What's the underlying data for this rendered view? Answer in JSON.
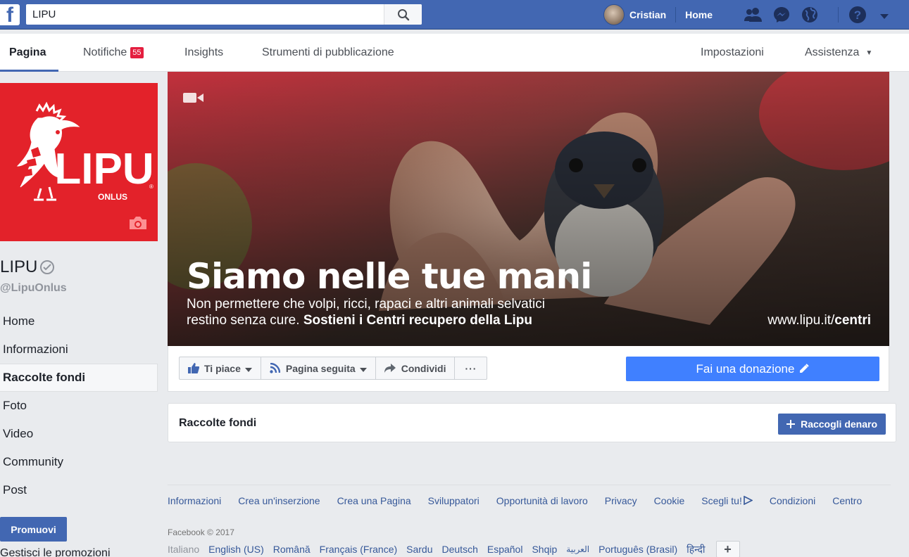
{
  "topbar": {
    "search_value": "LIPU",
    "user_name": "Cristian",
    "home_label": "Home",
    "brand_color": "#4267b2"
  },
  "page_tabs": [
    {
      "label": "Pagina",
      "active": true
    },
    {
      "label": "Notifiche",
      "badge": "55"
    },
    {
      "label": "Insights"
    },
    {
      "label": "Strumenti di pubblicazione"
    },
    {
      "label": "Impostazioni"
    },
    {
      "label": "Assistenza",
      "dropdown": true
    }
  ],
  "profile": {
    "logo_text": "LIPU",
    "logo_sub": "ONLUS",
    "page_name": "LIPU",
    "username": "@LipuOnlus",
    "logo_bg": "#e3222a"
  },
  "nav": [
    {
      "label": "Home"
    },
    {
      "label": "Informazioni"
    },
    {
      "label": "Raccolte fondi",
      "active": true
    },
    {
      "label": "Foto"
    },
    {
      "label": "Video"
    },
    {
      "label": "Community"
    },
    {
      "label": "Post"
    }
  ],
  "promote": {
    "button": "Promuovi",
    "manage": "Gestisci le promozioni"
  },
  "cover": {
    "title": "Siamo nelle tue mani",
    "line1": "Non permettere che volpi, ricci, rapaci e altri animali selvatici",
    "line2_a": "restino senza cure. ",
    "line2_b": "Sostieni i Centri recupero della Lipu",
    "url_a": "www.lipu.it/",
    "url_b": "centri"
  },
  "actions": {
    "like": "Ti piace",
    "follow": "Pagina seguita",
    "share": "Condividi",
    "more": "···",
    "donate": "Fai una donazione"
  },
  "fundraisers": {
    "title": "Raccolte fondi",
    "button": "Raccogli denaro"
  },
  "footer": {
    "links": [
      "Informazioni",
      "Crea un'inserzione",
      "Crea una Pagina",
      "Sviluppatori",
      "Opportunità di lavoro",
      "Privacy",
      "Cookie",
      "Scegli tu!",
      "Condizioni",
      "Centro"
    ],
    "copyright": "Facebook © 2017",
    "current_language": "Italiano",
    "languages": [
      "English (US)",
      "Română",
      "Français (France)",
      "Sardu",
      "Deutsch",
      "Español",
      "Shqip",
      "العربية",
      "Português (Brasil)",
      "हिन्दी"
    ]
  }
}
